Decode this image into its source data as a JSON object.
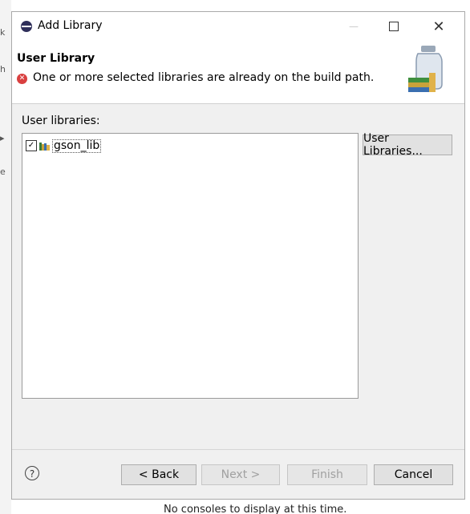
{
  "background": {
    "left_glyphs": [
      "k",
      "h",
      "▸",
      "e"
    ],
    "console_text": "No consoles to display at this time."
  },
  "window": {
    "title": "Add Library",
    "controls": {
      "minimize": "—",
      "maximize": "□",
      "close": "✕"
    }
  },
  "header": {
    "title": "User Library",
    "error_message": "One or more selected libraries are already on the build path.",
    "icon": "jar-library-icon"
  },
  "user_libraries": {
    "label": "User libraries:",
    "items": [
      {
        "label": "gson_lib",
        "checked": true,
        "icon": "library-icon"
      }
    ],
    "manage_button": "User Libraries..."
  },
  "footer": {
    "help_label": "?",
    "back_label": "< Back",
    "next_label": "Next >",
    "finish_label": "Finish",
    "cancel_label": "Cancel",
    "next_enabled": false,
    "finish_enabled": false
  },
  "colors": {
    "error": "#d94040",
    "dialog_bg": "#f0f0f0",
    "header_bg": "#ffffff"
  }
}
